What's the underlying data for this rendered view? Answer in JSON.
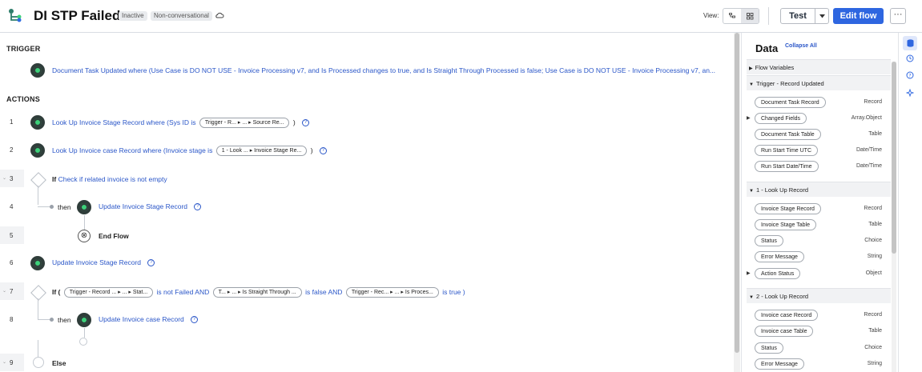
{
  "header": {
    "title": "DI STP Failed",
    "badge_inactive": "Inactive",
    "badge_nonconv": "Non-conversational",
    "view_label": "View:",
    "test_label": "Test",
    "edit_label": "Edit flow",
    "more_label": "···"
  },
  "canvas": {
    "trigger_heading": "TRIGGER",
    "actions_heading": "ACTIONS",
    "trigger_text": "Document Task Updated where (Use Case is DO NOT USE - Invoice Processing v7, and Is Processed changes to true, and Is Straight Through Processed is false; Use Case is DO NOT USE - Invoice Processing v7, an...",
    "rows": [
      {
        "num": "1",
        "prefix": "Look Up Invoice Stage Record where (Sys ID is",
        "pill": "Trigger - R... ▸ ... ▸ Source Re...",
        "suffix": ")"
      },
      {
        "num": "2",
        "prefix": "Look Up Invoice case Record where (Invoice stage is",
        "pill": "1 - Look ... ▸ Invoice Stage Re...",
        "suffix": ")"
      },
      {
        "num": "3",
        "if": "If",
        "text": "Check if related invoice is not empty"
      },
      {
        "num": "4",
        "then": "then",
        "text": "Update Invoice Stage Record"
      },
      {
        "num": "5",
        "text": "End Flow"
      },
      {
        "num": "6",
        "text": "Update Invoice Stage Record"
      },
      {
        "num": "7",
        "if": "If (",
        "pill1": "Trigger - Record ... ▸ ... ▸ Stat...",
        "mid1": "is not Failed AND",
        "pill2": "T... ▸ ... ▸ Is Straight Through ...",
        "mid2": "is false AND",
        "pill3": "Trigger - Rec... ▸ ... ▸ Is Proces...",
        "end": "is true )"
      },
      {
        "num": "8",
        "then": "then",
        "text": "Update Invoice case Record"
      },
      {
        "num": "9",
        "text": "Else"
      }
    ]
  },
  "data_panel": {
    "title": "Data",
    "collapse_all": "Collapse All",
    "flow_variables": "Flow Variables",
    "sections": [
      {
        "label": "Trigger - Record Updated",
        "items": [
          {
            "name": "Document Task Record",
            "type": "Record"
          },
          {
            "name": "Changed Fields",
            "type": "Array.Object"
          },
          {
            "name": "Document Task Table",
            "type": "Table"
          },
          {
            "name": "Run Start Time UTC",
            "type": "Date/Time"
          },
          {
            "name": "Run Start Date/Time",
            "type": "Date/Time"
          }
        ]
      },
      {
        "label": "1 - Look Up Record",
        "items": [
          {
            "name": "Invoice Stage Record",
            "type": "Record"
          },
          {
            "name": "Invoice Stage Table",
            "type": "Table"
          },
          {
            "name": "Status",
            "type": "Choice"
          },
          {
            "name": "Error Message",
            "type": "String"
          },
          {
            "name": "Action Status",
            "type": "Object"
          }
        ]
      },
      {
        "label": "2 - Look Up Record",
        "items": [
          {
            "name": "Invoice case Record",
            "type": "Record"
          },
          {
            "name": "Invoice case Table",
            "type": "Table"
          },
          {
            "name": "Status",
            "type": "Choice"
          },
          {
            "name": "Error Message",
            "type": "String"
          }
        ]
      }
    ]
  }
}
